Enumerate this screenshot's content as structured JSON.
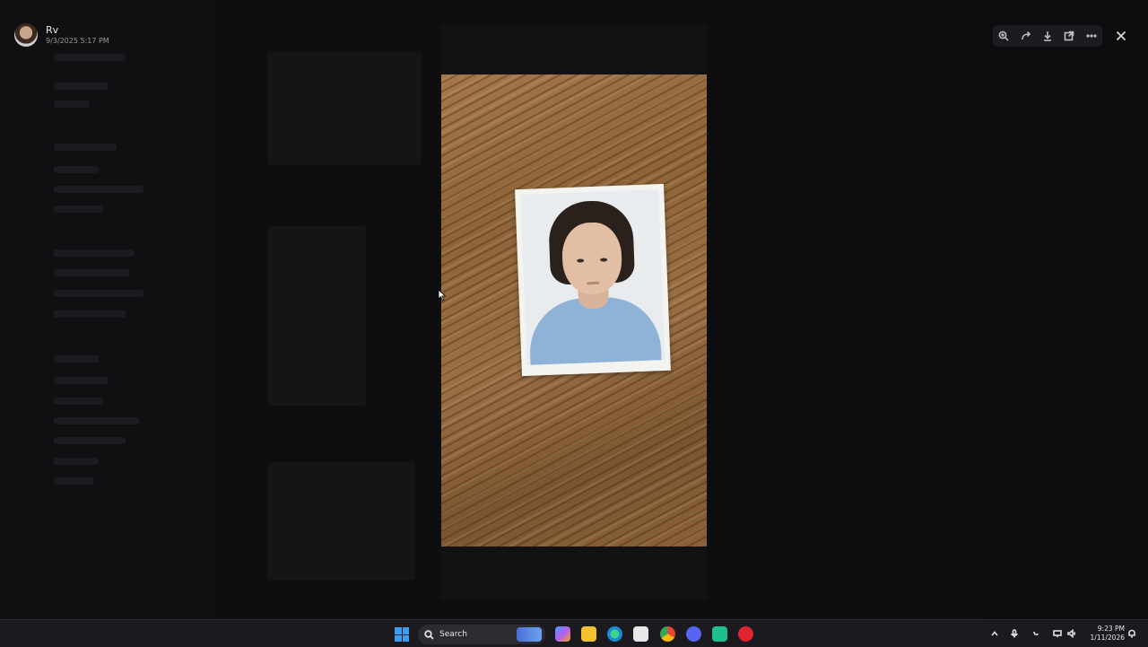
{
  "viewer": {
    "author_name": "Rv",
    "timestamp": "9/3/2025 5:17 PM",
    "toolbar": {
      "icons": [
        "zoom-in-icon",
        "forward-icon",
        "download-icon",
        "open-external-icon",
        "more-icon"
      ],
      "close_icon": "close-icon"
    }
  },
  "taskbar": {
    "search_placeholder": "Search",
    "apps": [
      "copilot-icon",
      "file-explorer-icon",
      "edge-icon",
      "store-icon",
      "chrome-icon",
      "discord-icon",
      "app-green-icon",
      "app-red-icon"
    ],
    "time": "9:23 PM",
    "date": "1/11/2026"
  },
  "colors": {
    "accent": "#3a9df0",
    "taskbar_bg": "#1b1b1f",
    "backdrop": "#0b0b0d"
  }
}
